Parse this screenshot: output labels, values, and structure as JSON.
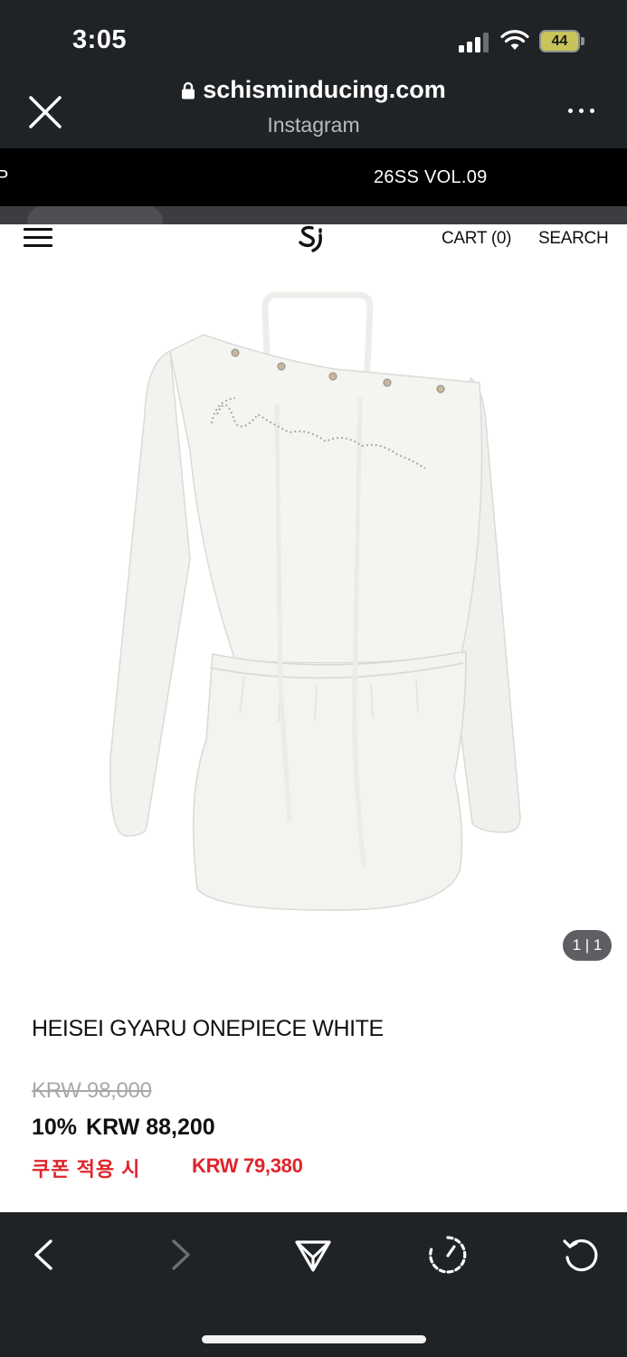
{
  "status_bar": {
    "time": "3:05",
    "battery_level": "44"
  },
  "browser": {
    "url": "schisminducing.com",
    "source": "Instagram",
    "icons": [
      "close-icon",
      "lock-icon",
      "more-icon"
    ]
  },
  "announcement": {
    "text": "26SS VOL.09",
    "edge_glyph": "P"
  },
  "site_header": {
    "cart_label": "CART (0)",
    "search_label": "SEARCH",
    "icons": [
      "menu-icon",
      "logo-icon"
    ]
  },
  "product": {
    "pager": "1 | 1",
    "name": "HEISEI GYARU ONEPIECE WHITE",
    "original_price": "KRW 98,000",
    "discount": "10%",
    "sale_price": "KRW 88,200",
    "coupon_label": "쿠폰 적용 시",
    "coupon_price": "KRW 79,380"
  },
  "colors": {
    "chrome_bg": "#202326",
    "announce_bg": "#000000",
    "coupon_red": "#e0242b",
    "strike_gray": "#a9a9a9"
  },
  "toolbar": {
    "icons": [
      "back-icon",
      "forward-icon",
      "share-icon",
      "speed-icon",
      "reload-icon"
    ]
  }
}
